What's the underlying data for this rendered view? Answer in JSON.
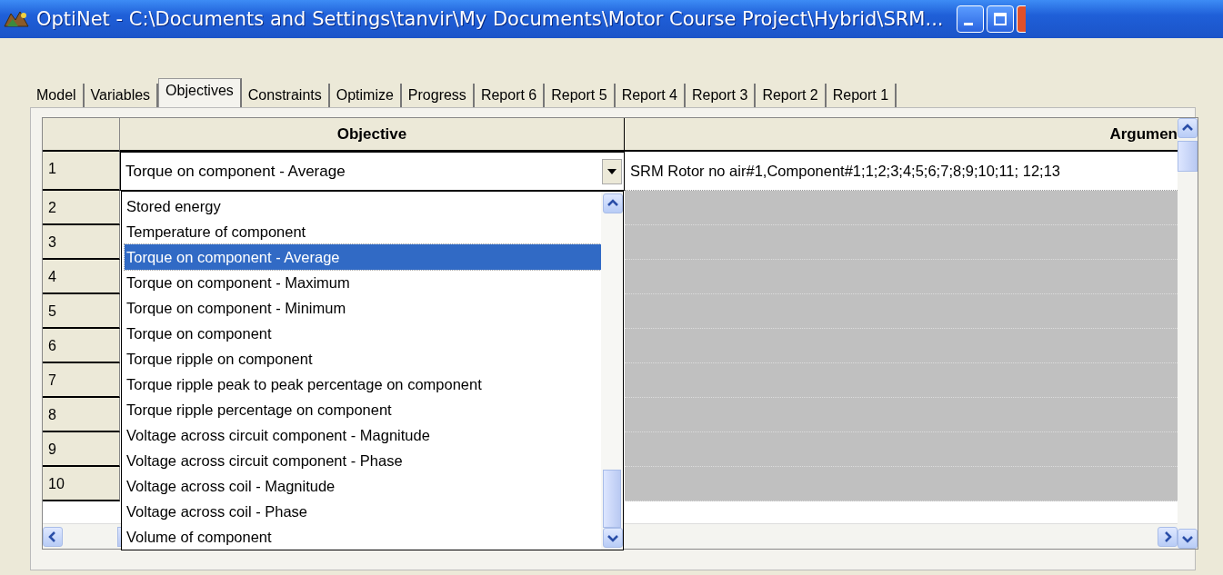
{
  "window": {
    "title": "OptiNet - C:\\Documents and Settings\\tanvir\\My Documents\\Motor Course Project\\Hybrid\\SRM..."
  },
  "tabs": [
    {
      "label": "Model",
      "selected": false
    },
    {
      "label": "Variables",
      "selected": false
    },
    {
      "label": "Objectives",
      "selected": true
    },
    {
      "label": "Constraints",
      "selected": false
    },
    {
      "label": "Optimize",
      "selected": false
    },
    {
      "label": "Progress",
      "selected": false
    },
    {
      "label": "Report 6",
      "selected": false
    },
    {
      "label": "Report 5",
      "selected": false
    },
    {
      "label": "Report 4",
      "selected": false
    },
    {
      "label": "Report 3",
      "selected": false
    },
    {
      "label": "Report 2",
      "selected": false
    },
    {
      "label": "Report 1",
      "selected": false
    }
  ],
  "grid": {
    "columns": [
      "Objective",
      "Argumen"
    ],
    "rows": [
      {
        "number": "1",
        "objective": "Torque on component - Average",
        "argument": "SRM Rotor no air#1,Component#1;1;2;3;4;5;6;7;8;9;10;11; 12;13"
      },
      {
        "number": "2"
      },
      {
        "number": "3"
      },
      {
        "number": "4"
      },
      {
        "number": "5"
      },
      {
        "number": "6"
      },
      {
        "number": "7"
      },
      {
        "number": "8"
      },
      {
        "number": "9"
      },
      {
        "number": "10"
      }
    ]
  },
  "dropdown": {
    "items": [
      {
        "label": "Stored energy",
        "selected": false
      },
      {
        "label": "Temperature of component",
        "selected": false
      },
      {
        "label": "Torque on component - Average",
        "selected": true
      },
      {
        "label": "Torque on component - Maximum",
        "selected": false
      },
      {
        "label": "Torque on component - Minimum",
        "selected": false
      },
      {
        "label": "Torque on component",
        "selected": false
      },
      {
        "label": "Torque ripple on component",
        "selected": false
      },
      {
        "label": "Torque ripple peak to peak percentage on component",
        "selected": false
      },
      {
        "label": "Torque ripple percentage on component",
        "selected": false
      },
      {
        "label": "Voltage across circuit component - Magnitude",
        "selected": false
      },
      {
        "label": "Voltage across circuit component - Phase",
        "selected": false
      },
      {
        "label": "Voltage across coil - Magnitude",
        "selected": false
      },
      {
        "label": "Voltage across coil - Phase",
        "selected": false
      },
      {
        "label": "Volume of component",
        "selected": false
      }
    ]
  }
}
